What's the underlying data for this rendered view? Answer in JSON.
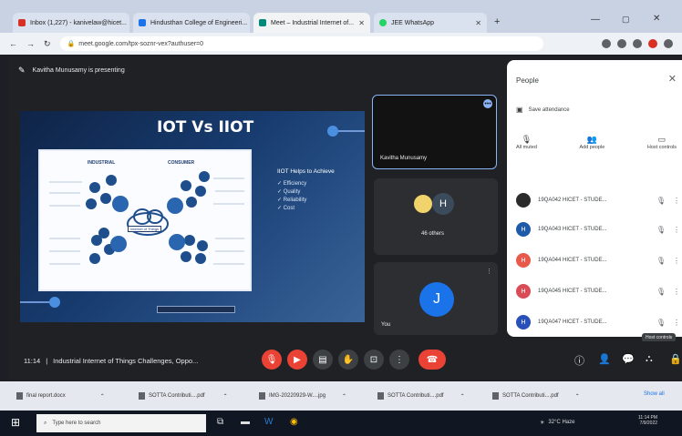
{
  "browser": {
    "tabs": [
      {
        "label": "Inbox (1,227) - kanivelaw@hicet...",
        "color": "#d93025"
      },
      {
        "label": "Hindusthan College of Engineeri...",
        "color": "#1a73e8"
      },
      {
        "label": "Meet – Industrial Internet of...",
        "color": "#00897b"
      },
      {
        "label": "JEE WhatsApp",
        "color": "#25d366"
      }
    ],
    "url": "meet.google.com/tpx-soznr-vex?authuser=0"
  },
  "meet": {
    "presenting_text": "Kavitha Munusamy is presenting",
    "slide": {
      "title": "IOT Vs IIOT",
      "side_heading": "IIOT Helps to Achieve",
      "side_items": [
        "Efficiency",
        "Quality",
        "Reliability",
        "Cost"
      ],
      "diagram_left_heading": "INDUSTRIAL",
      "diagram_right_heading": "CONSUMER",
      "diagram_center": "Internet of Things"
    },
    "tiles": [
      {
        "name": "Kavitha Munusamy"
      },
      {
        "name": "46 others",
        "initial": "H"
      },
      {
        "name": "You",
        "initial": "J"
      }
    ],
    "meeting_time": "11:14",
    "meeting_title": "Industrial Internet of Things Challenges, Oppo..."
  },
  "people": {
    "title": "People",
    "save_attendance": "Save attendance",
    "actions": [
      "All muted",
      "Add people",
      "Host controls"
    ],
    "participants": [
      {
        "name": "19QA042 HICET - STUDE...",
        "initial": "",
        "color": "#2b2b2b"
      },
      {
        "name": "19QA043 HICET - STUDE...",
        "initial": "H",
        "color": "#1e5aa8"
      },
      {
        "name": "19QA044 HICET - STUDE...",
        "initial": "H",
        "color": "#e8594b"
      },
      {
        "name": "19QA045 HICET - STUDE...",
        "initial": "H",
        "color": "#d94b55"
      },
      {
        "name": "19QA047 HICET - STUDE...",
        "initial": "H",
        "color": "#2850b8"
      }
    ],
    "tooltip": "Host controls"
  },
  "downloads": [
    {
      "label": "final report.docx"
    },
    {
      "label": "SOTTA Contributi....pdf"
    },
    {
      "label": "IMG-20220929-W....jpg"
    },
    {
      "label": "SOTTA Contributi....pdf"
    },
    {
      "label": "SOTTA Contributi....pdf"
    }
  ],
  "downloads_show_all": "Show all",
  "taskbar": {
    "search_placeholder": "Type here to search",
    "weather": "32°C  Haze",
    "time": "11:14 PM",
    "date": "7/9/2022"
  },
  "colors": {
    "accent": "#8ab4f8",
    "hangup": "#ea4335",
    "avatar_blue": "#1a73e8"
  }
}
